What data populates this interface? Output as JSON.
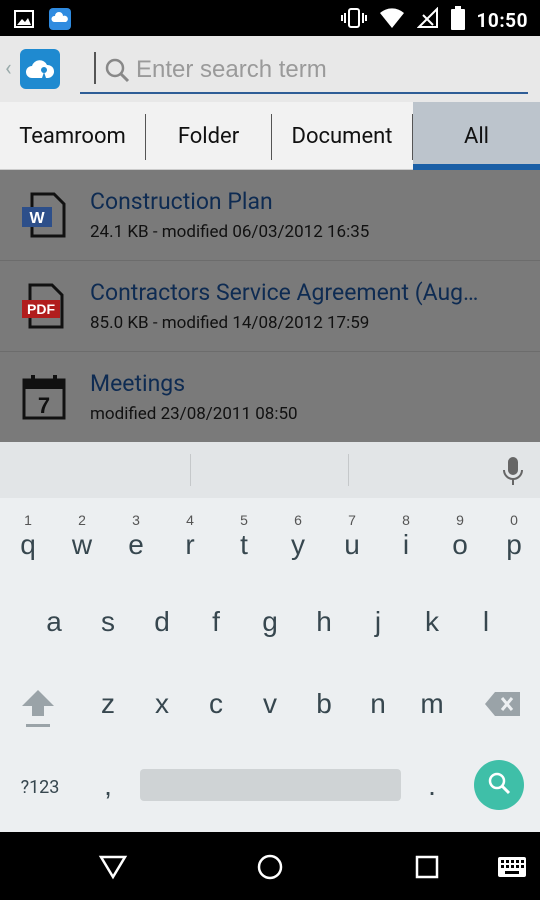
{
  "status_bar": {
    "time": "10:50",
    "icons": [
      "image-icon",
      "cloud-app-icon",
      "vibrate-icon",
      "wifi-icon",
      "no-signal-icon",
      "battery-icon"
    ]
  },
  "header": {
    "back_label": "‹",
    "search": {
      "placeholder": "Enter search term",
      "value": ""
    }
  },
  "tabs": [
    {
      "label": "Teamroom",
      "active": false
    },
    {
      "label": "Folder",
      "active": false
    },
    {
      "label": "Document",
      "active": false
    },
    {
      "label": "All",
      "active": true
    }
  ],
  "items": [
    {
      "title": "Construction Plan",
      "meta": "24.1 KB - modified 06/03/2012 16:35",
      "icon": "word-doc-icon"
    },
    {
      "title": "Contractors Service Agreement (Aug…",
      "meta": "85.0 KB - modified 14/08/2012 17:59",
      "icon": "pdf-doc-icon"
    },
    {
      "title": "Meetings",
      "meta": "modified 23/08/2011 08:50",
      "icon": "calendar-icon"
    }
  ],
  "keyboard": {
    "row1": [
      {
        "letter": "q",
        "num": "1"
      },
      {
        "letter": "w",
        "num": "2"
      },
      {
        "letter": "e",
        "num": "3"
      },
      {
        "letter": "r",
        "num": "4"
      },
      {
        "letter": "t",
        "num": "5"
      },
      {
        "letter": "y",
        "num": "6"
      },
      {
        "letter": "u",
        "num": "7"
      },
      {
        "letter": "i",
        "num": "8"
      },
      {
        "letter": "o",
        "num": "9"
      },
      {
        "letter": "p",
        "num": "0"
      }
    ],
    "row2": [
      "a",
      "s",
      "d",
      "f",
      "g",
      "h",
      "j",
      "k",
      "l"
    ],
    "row3": [
      "z",
      "x",
      "c",
      "v",
      "b",
      "n",
      "m"
    ],
    "symbols_label": "?123",
    "comma": ",",
    "period": "."
  },
  "colors": {
    "accent_blue": "#1a5fa6",
    "title_blue": "#0e2b52",
    "search_fab": "#3fbfa8"
  }
}
